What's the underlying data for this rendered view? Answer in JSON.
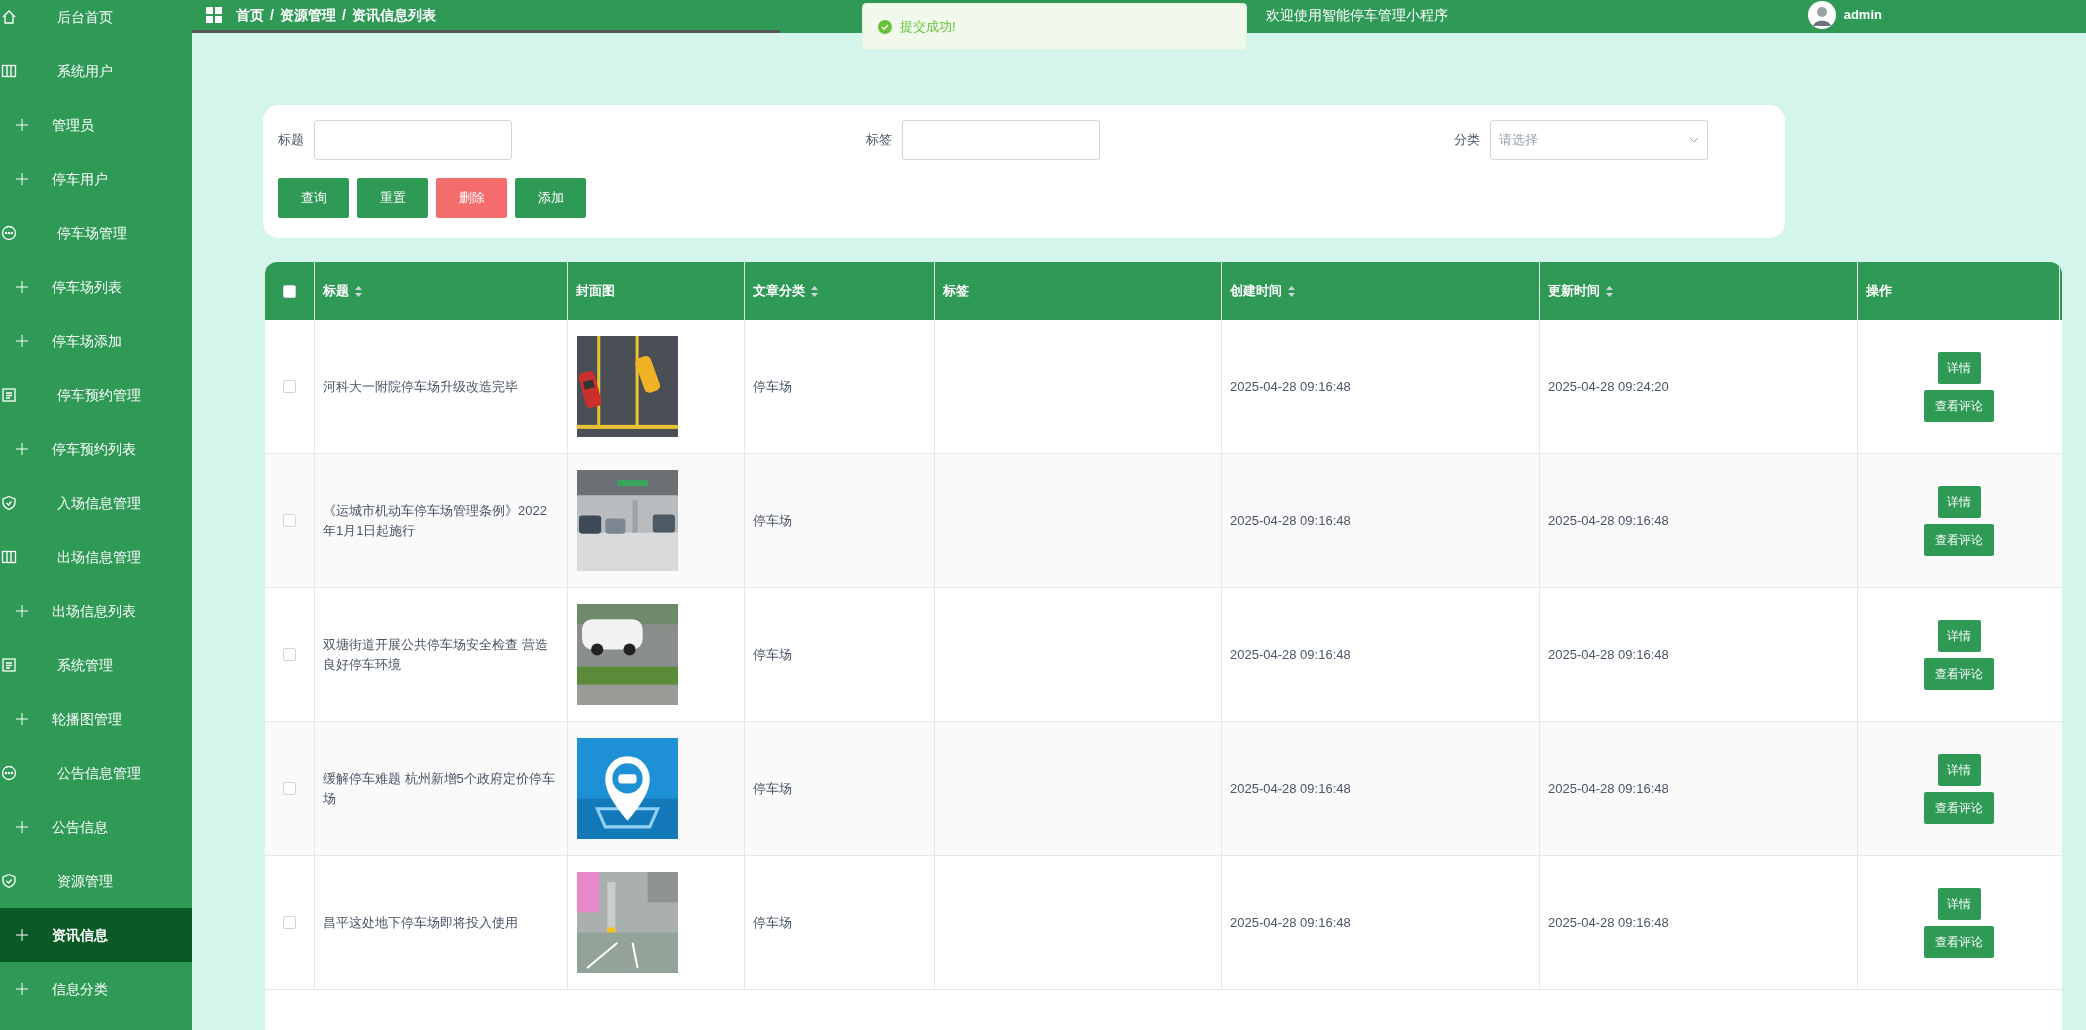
{
  "sidebar": {
    "items": [
      {
        "label": "后台首页",
        "kind": "home",
        "selected": false
      },
      {
        "label": "系统用户",
        "kind": "columns",
        "selected": false,
        "children": [
          {
            "label": "管理员",
            "selected": false
          },
          {
            "label": "停车用户",
            "selected": false
          }
        ]
      },
      {
        "label": "停车场管理",
        "kind": "dots",
        "selected": false,
        "children": [
          {
            "label": "停车场列表",
            "selected": false
          },
          {
            "label": "停车场添加",
            "selected": false
          }
        ]
      },
      {
        "label": "停车预约管理",
        "kind": "doc",
        "selected": false,
        "children": [
          {
            "label": "停车预约列表",
            "selected": false
          }
        ]
      },
      {
        "label": "入场信息管理",
        "kind": "shield",
        "selected": false
      },
      {
        "label": "出场信息管理",
        "kind": "columns",
        "selected": false,
        "children": [
          {
            "label": "出场信息列表",
            "selected": false
          }
        ]
      },
      {
        "label": "系统管理",
        "kind": "doc",
        "selected": false,
        "children": [
          {
            "label": "轮播图管理",
            "selected": false
          }
        ]
      },
      {
        "label": "公告信息管理",
        "kind": "dots",
        "selected": false,
        "children": [
          {
            "label": "公告信息",
            "selected": false
          }
        ]
      },
      {
        "label": "资源管理",
        "kind": "shield",
        "selected": false,
        "children": [
          {
            "label": "资讯信息",
            "selected": true
          },
          {
            "label": "信息分类",
            "selected": false
          }
        ]
      }
    ]
  },
  "header": {
    "breadcrumb": [
      "首页",
      "资源管理",
      "资讯信息列表"
    ],
    "separator": "/",
    "title": "欢迎使用智能停车管理小程序",
    "user": "admin"
  },
  "toast": {
    "kind": "success",
    "message": "提交成功!"
  },
  "filters": {
    "fields": [
      {
        "label": "标题",
        "kind": "input"
      },
      {
        "label": "标签",
        "kind": "input"
      },
      {
        "label": "分类",
        "kind": "select",
        "placeholder": "请选择"
      }
    ],
    "buttons": [
      {
        "label": "查询",
        "kind": "primary"
      },
      {
        "label": "重置",
        "kind": "primary"
      },
      {
        "label": "删除",
        "kind": "danger"
      },
      {
        "label": "添加",
        "kind": "primary"
      }
    ]
  },
  "table": {
    "select_all": {
      "checked": false
    },
    "columns": [
      {
        "label": "标题",
        "sortable": true
      },
      {
        "label": "封面图",
        "sortable": false
      },
      {
        "label": "文章分类",
        "sortable": true
      },
      {
        "label": "标签",
        "sortable": false
      },
      {
        "label": "创建时间",
        "sortable": true
      },
      {
        "label": "更新时间",
        "sortable": true
      },
      {
        "label": "操作",
        "sortable": false
      }
    ],
    "rows": [
      {
        "checked": false,
        "title": "河科大一附院停车场升级改造完毕",
        "cover": {
          "kind": "picture"
        },
        "category": "停车场",
        "created": "2025-04-28 09:16:48",
        "updated": "2025-04-28 09:24:20",
        "actions": [
          "详情",
          "查看评论"
        ]
      },
      {
        "checked": false,
        "title": "《运城市机动车停车场管理条例》2022年1月1日起施行",
        "cover": {
          "kind": "picture"
        },
        "category": "停车场",
        "created": "2025-04-28 09:16:48",
        "updated": "2025-04-28 09:16:48",
        "actions": [
          "详情",
          "查看评论"
        ]
      },
      {
        "checked": false,
        "title": "双塘街道开展公共停车场安全检查 营造良好停车环境",
        "cover": {
          "kind": "picture"
        },
        "category": "停车场",
        "created": "2025-04-28 09:16:48",
        "updated": "2025-04-28 09:16:48",
        "actions": [
          "详情",
          "查看评论"
        ]
      },
      {
        "checked": false,
        "title": "缓解停车难题 杭州新增5个政府定价停车场",
        "cover": {
          "kind": "picture"
        },
        "category": "停车场",
        "created": "2025-04-28 09:16:48",
        "updated": "2025-04-28 09:16:48",
        "actions": [
          "详情",
          "查看评论"
        ]
      },
      {
        "checked": false,
        "title": "昌平这处地下停车场即将投入使用",
        "cover": {
          "kind": "picture"
        },
        "category": "停车场",
        "created": "2025-04-28 09:16:48",
        "updated": "2025-04-28 09:16:48",
        "actions": [
          "详情",
          "查看评论"
        ]
      }
    ]
  }
}
